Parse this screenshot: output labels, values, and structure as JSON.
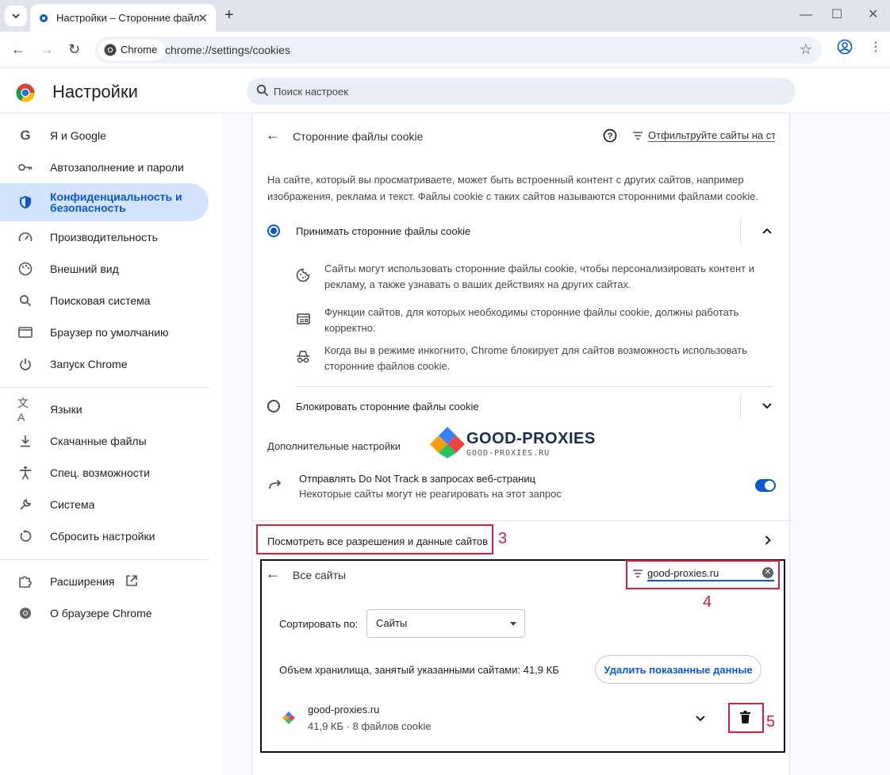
{
  "tab": {
    "title": "Настройки – Сторонние файлы cookie",
    "close": "✕",
    "new_tab": "+"
  },
  "window_controls": {
    "minimize": "—",
    "maximize": "☐",
    "close": "✕"
  },
  "toolbar": {
    "chip_label": "Chrome",
    "url": "chrome://settings/cookies"
  },
  "header": {
    "title": "Настройки",
    "search_placeholder": "Поиск настроек"
  },
  "sidebar": {
    "items": [
      {
        "label": "Я и Google",
        "icon": "google-g-icon"
      },
      {
        "label": "Автозаполнение и пароли",
        "icon": "key-icon"
      },
      {
        "label": "Конфиденциальность и безопасность",
        "icon": "shield-icon",
        "active": true
      },
      {
        "label": "Производительность",
        "icon": "speedometer-icon"
      },
      {
        "label": "Внешний вид",
        "icon": "palette-icon"
      },
      {
        "label": "Поисковая система",
        "icon": "search-icon"
      },
      {
        "label": "Браузер по умолчанию",
        "icon": "browser-window-icon"
      },
      {
        "label": "Запуск Chrome",
        "icon": "power-icon"
      },
      {
        "label": "Языки",
        "icon": "translate-icon"
      },
      {
        "label": "Скачанные файлы",
        "icon": "download-icon"
      },
      {
        "label": "Спец. возможности",
        "icon": "accessibility-icon"
      },
      {
        "label": "Система",
        "icon": "wrench-icon"
      },
      {
        "label": "Сбросить настройки",
        "icon": "reset-icon"
      },
      {
        "label": "Расширения",
        "icon": "puzzle-icon"
      },
      {
        "label": "О браузере Chrome",
        "icon": "chrome-icon"
      }
    ]
  },
  "cookies_page": {
    "title": "Сторонние файлы cookie",
    "filter_link": "Отфильтруйте сайты на стр...",
    "description": "На сайте, который вы просматриваете, может быть встроенный контент с других сайтов, например изображения, реклама и текст. Файлы cookie с таких сайтов называются сторонними файлами cookie.",
    "allow_option": "Принимать сторонние файлы cookie",
    "allow_details": [
      {
        "icon": "cookie-icon",
        "text": "Сайты могут использовать сторонние файлы cookie, чтобы персонализировать контент и рекламу, а также узнавать о ваших действиях на других сайтах."
      },
      {
        "icon": "web-panel-icon",
        "text": "Функции сайтов, для которых необходимы сторонние файлы cookie, должны работать корректно."
      },
      {
        "icon": "incognito-icon",
        "text": "Когда вы в режиме инкогнито, Chrome блокирует для сайтов возможность использовать сторонние файлов cookie."
      }
    ],
    "block_option": "Блокировать сторонние файлы cookie",
    "advanced_heading": "Дополнительные настройки",
    "dnt_title": "Отправлять Do Not Track в запросах веб-страниц",
    "dnt_subtitle": "Некоторые сайты могут не реагировать на этот запрос",
    "dnt_enabled": true,
    "view_all_link": "Посмотреть все разрешения и данные сайтов"
  },
  "watermark": {
    "brand": "GOOD-PROXIES",
    "domain": "GOOD-PROXIES.RU"
  },
  "all_sites": {
    "title": "Все сайты",
    "filter_value": "good-proxies.ru",
    "sort_label": "Сортировать по:",
    "sort_value": "Сайты",
    "storage_text": "Объем хранилища, занятый указанными сайтами: 41,9 КБ",
    "delete_button": "Удалить показанные данные",
    "site": {
      "name": "good-proxies.ru",
      "meta": "41,9 КБ · 8 файлов cookie"
    }
  },
  "annotations": {
    "step3": "3",
    "step4": "4",
    "step5": "5"
  },
  "colors": {
    "accent": "#0b57d0",
    "annotation": "#d0213f",
    "active_nav_bg": "#d3e3fd"
  }
}
